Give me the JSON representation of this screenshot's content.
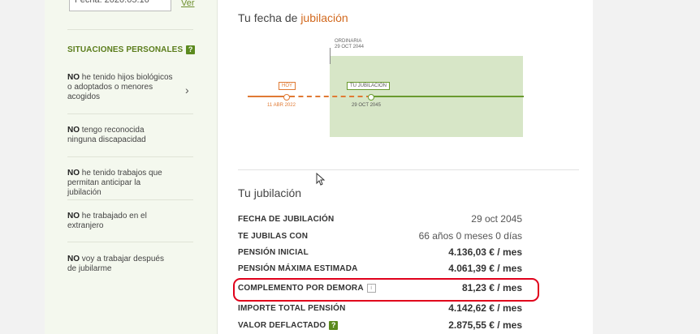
{
  "sidebar": {
    "date_value": "Fecha: 2020.05.16",
    "top_link": "Ver",
    "section_title": "SITUACIONES PERSONALES",
    "section_help": "?",
    "items": [
      {
        "bold": "NO",
        "text": " he tenido hijos biológicos o adoptados o menores acogidos"
      },
      {
        "bold": "NO",
        "text": " tengo reconocida ninguna discapacidad"
      },
      {
        "bold": "NO",
        "text": " he tenido trabajos que permitan anticipar la jubilación"
      },
      {
        "bold": "NO",
        "text": " he trabajado en el extranjero"
      },
      {
        "bold": "NO",
        "text": " voy a trabajar después de jubilarme"
      }
    ]
  },
  "retirement_date": {
    "title_prefix": "Tu fecha de ",
    "title_highlight": "jubilación",
    "timeline": {
      "ordinaria_label": "ORDINARIA",
      "ordinaria_date": "29 OCT 2044",
      "hoy_label": "HOY",
      "hoy_date": "11 ABR 2022",
      "jubilacion_label": "TU JUBILACIÓN",
      "jubilacion_date": "29 OCT 2045"
    }
  },
  "summary": {
    "title": "Tu jubilación",
    "rows": [
      {
        "label": "FECHA DE JUBILACIÓN",
        "value": "29 oct 2045"
      },
      {
        "label": "TE JUBILAS CON",
        "value": "66 años 0 meses 0 días"
      },
      {
        "label": "PENSIÓN INICIAL",
        "value": "4.136,03 € / mes"
      },
      {
        "label": "PENSIÓN MÁXIMA ESTIMADA",
        "value": "4.061,39 € / mes"
      },
      {
        "label": "COMPLEMENTO POR DEMORA",
        "value": "81,23 € / mes"
      },
      {
        "label": "IMPORTE TOTAL PENSIÓN",
        "value": "4.142,62 € / mes"
      },
      {
        "label": "VALOR DEFLACTADO",
        "value": "2.875,55 € / mes"
      }
    ]
  },
  "colors": {
    "accent_green": "#5b8a1e",
    "accent_orange": "#e07a34",
    "highlight_red": "#e0001b"
  }
}
